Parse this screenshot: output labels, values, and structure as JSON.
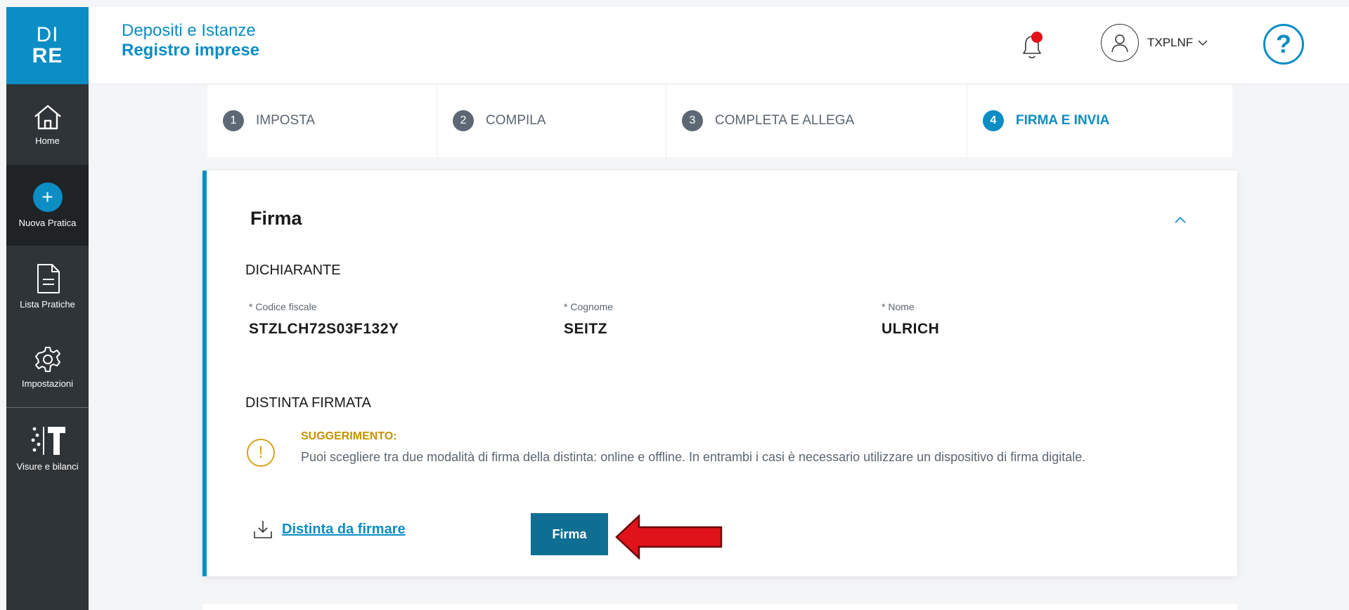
{
  "sidebar": {
    "logo_line1": "DI",
    "logo_line2": "RE",
    "items": [
      {
        "label": "Home",
        "icon": "home-icon"
      },
      {
        "label": "Nuova Pratica",
        "icon": "plus-icon"
      },
      {
        "label": "Lista Pratiche",
        "icon": "document-icon"
      },
      {
        "label": "Impostazioni",
        "icon": "gear-icon"
      },
      {
        "label": "Visure e bilanci",
        "icon": "visure-icon"
      }
    ]
  },
  "header": {
    "title": "Depositi e Istanze",
    "subtitle": "Registro imprese",
    "username": "TXPLNF",
    "help": "?"
  },
  "stepper": [
    {
      "num": "1",
      "label": "IMPOSTA"
    },
    {
      "num": "2",
      "label": "COMPILA"
    },
    {
      "num": "3",
      "label": "COMPLETA E ALLEGA"
    },
    {
      "num": "4",
      "label": "FIRMA E INVIA"
    }
  ],
  "card": {
    "title": "Firma",
    "dichiarante_label": "DICHIARANTE",
    "fields": [
      {
        "label": "* Codice fiscale",
        "value": "STZLCH72S03F132Y"
      },
      {
        "label": "* Cognome",
        "value": "SEITZ"
      },
      {
        "label": "* Nome",
        "value": "ULRICH"
      }
    ],
    "distinta_label": "DISTINTA FIRMATA",
    "tip_title": "SUGGERIMENTO:",
    "tip_text": "Puoi scegliere tra due modalità di firma della distinta: online e offline. In entrambi i casi è necessario utilizzare un dispositivo di firma digitale.",
    "download_link": "Distinta da firmare",
    "firma_button": "Firma"
  },
  "colors": {
    "accent": "#0c8dc4",
    "sidebar": "#2f3438",
    "warning": "#d9a21b",
    "button": "#0e6f93",
    "arrow": "#e0131a"
  }
}
